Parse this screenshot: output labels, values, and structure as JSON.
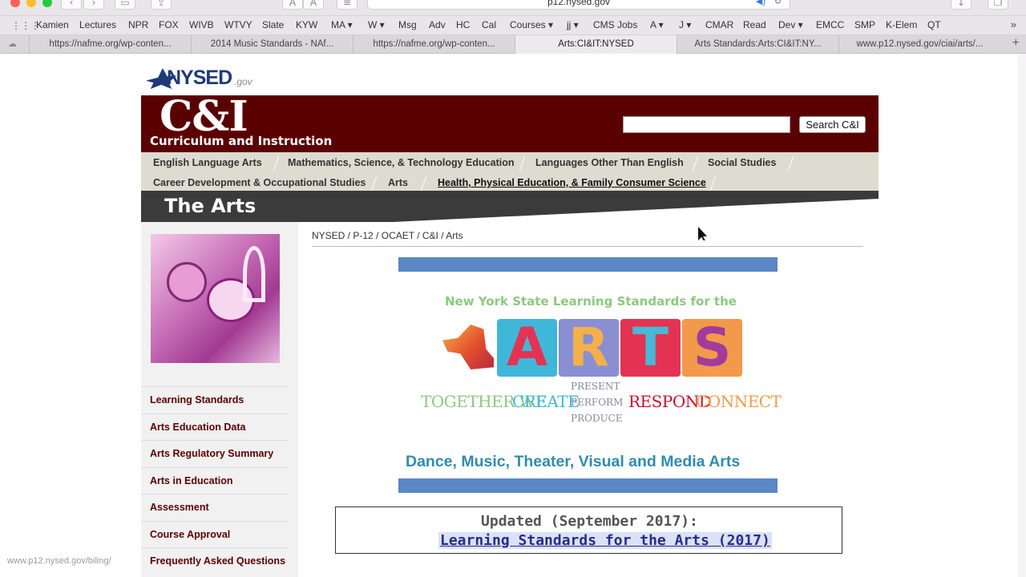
{
  "browser": {
    "url": "p12.nysed.gov",
    "bookmarks": [
      "Kamien",
      "Lectures",
      "NPR",
      "FOX",
      "WIVB",
      "WTVY",
      "Slate",
      "KYW",
      "MA ▾",
      "W ▾",
      "Msg",
      "Adv",
      "HC",
      "Cal",
      "Courses ▾",
      "jj ▾",
      "CMS Jobs",
      "A ▾",
      "J ▾",
      "CMAR",
      "Read",
      "Dev ▾",
      "EMCC",
      "SMP",
      "K-Elem",
      "QT"
    ],
    "tabs": [
      "https://nafme.org/wp-conten...",
      "2014 Music Standards - NAf...",
      "https://nafme.org/wp-conten...",
      "Arts:CI&IT:NYSED",
      "Arts Standards:Arts:CI&IT:NY...",
      "www.p12.nysed.gov/ciai/arts/..."
    ],
    "active_tab": 3,
    "status_url": "www.p12.nysed.gov/biling/"
  },
  "site": {
    "logo_text": "NYSED",
    "logo_gov": ".gov",
    "header_big": "C&I",
    "header_sub": "Curriculum and Instruction",
    "search_button": "Search C&I",
    "nav_row1": [
      "English Language Arts",
      "Mathematics, Science, & Technology Education",
      "Languages Other Than English",
      "Social Studies"
    ],
    "nav_row2": [
      "Career Development & Occupational Studies",
      "Arts",
      "Health, Physical Education, & Family Consumer Science"
    ],
    "section_title": "The Arts",
    "sidebar_links": [
      "Learning Standards",
      "Arts Education Data",
      "Arts Regulatory Summary",
      "Arts in Education",
      "Assessment",
      "Course Approval",
      "Frequently Asked Questions"
    ],
    "breadcrumb": [
      "NYSED",
      "P-12",
      "OCAET",
      "C&I",
      "Arts"
    ],
    "logo_banner": {
      "title": "New York State Learning Standards for the",
      "letters": [
        "A",
        "R",
        "T",
        "S"
      ],
      "tagline_together": "TOGETHER WE",
      "tagline_create": "CREATE",
      "tagline_present": "PRESENT",
      "tagline_perform": "PERFORM",
      "tagline_produce": "PRODUCE",
      "tagline_respond": "RESPOND",
      "tagline_connect": "CONNECT"
    },
    "disciplines": "Dance, Music, Theater, Visual and Media Arts",
    "update_heading": "Updated (September 2017):",
    "update_link": "Learning Standards for the Arts (2017)"
  },
  "colors": {
    "maroon": "#5b0000",
    "nav_bg": "#dcdcd0",
    "blue_bar": "#5b87c4",
    "letter_a": "#3fb7d9",
    "letter_r": "#8a8fd3",
    "letter_t": "#e43352",
    "letter_s": "#f29a4a"
  }
}
